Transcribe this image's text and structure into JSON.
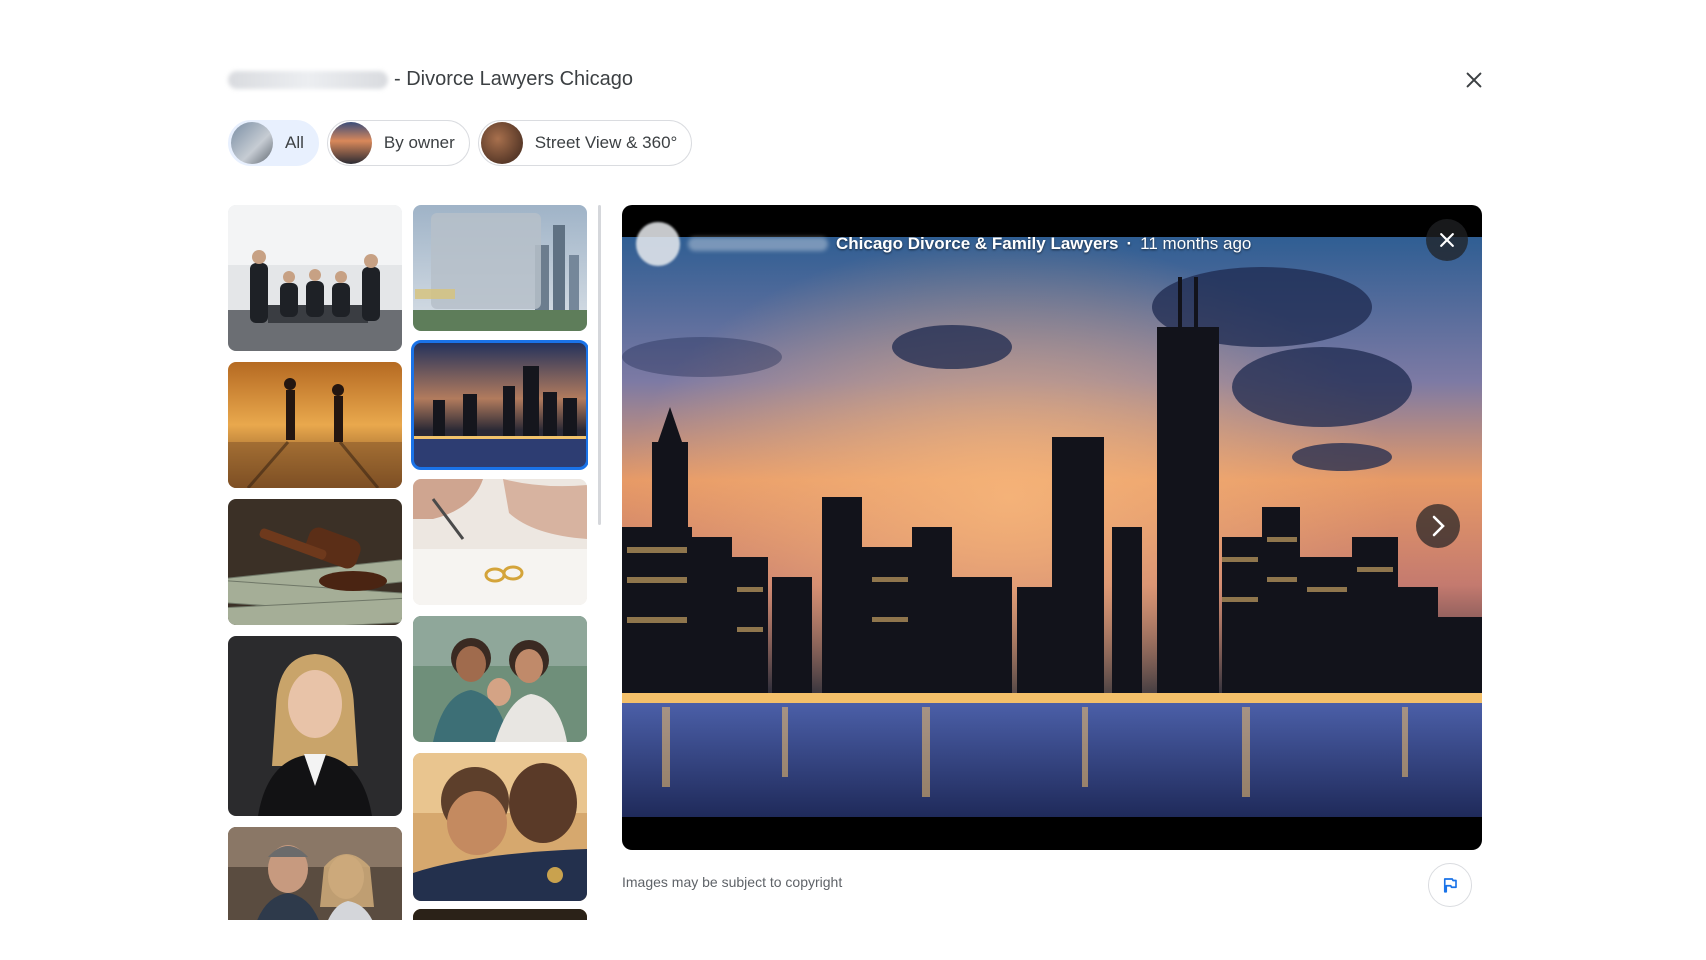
{
  "header": {
    "title_suffix": "- Divorce Lawyers Chicago",
    "close_icon": "close-icon"
  },
  "tabs": [
    {
      "label": "All",
      "active": true
    },
    {
      "label": "By owner",
      "active": false
    },
    {
      "label": "Street View & 360°",
      "active": false
    }
  ],
  "thumbnails": [
    {
      "subject": "team-photo"
    },
    {
      "subject": "city-skyline-blurred"
    },
    {
      "subject": "couple-silhouettes"
    },
    {
      "subject": "chicago-skyline-night",
      "selected": true
    },
    {
      "subject": "gavel-on-money"
    },
    {
      "subject": "signing-with-rings"
    },
    {
      "subject": "woman-portrait"
    },
    {
      "subject": "family-mother-child"
    },
    {
      "subject": "couple-back-to-back"
    },
    {
      "subject": "father-hugging-child"
    }
  ],
  "viewer": {
    "author": "Chicago Divorce & Family Lawyers",
    "separator": "·",
    "posted_ago": "11 months ago",
    "image_subject": "chicago-skyline-sunset",
    "prev_icon": "chevron-left-icon",
    "next_icon": "chevron-right-icon",
    "close_icon": "close-icon"
  },
  "footer": {
    "copyright_note": "Images may be subject to copyright",
    "report_icon": "flag-icon"
  },
  "colors": {
    "accent": "#1a73e8",
    "chip_active_bg": "#e8f0fe",
    "viewer_bg": "#000000"
  }
}
